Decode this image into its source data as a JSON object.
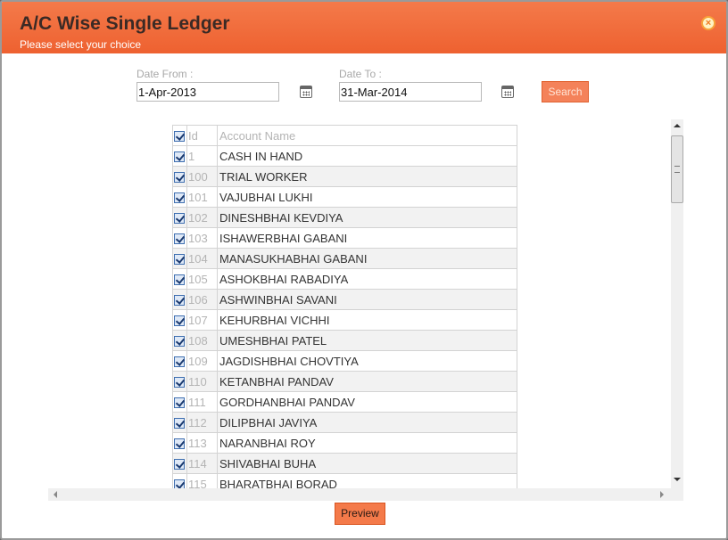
{
  "dialog": {
    "title": "A/C Wise Single Ledger",
    "subtitle": "Please select your choice",
    "close_icon": "close-icon"
  },
  "filters": {
    "date_from_label": "Date From :",
    "date_from_value": "1-Apr-2013",
    "date_to_label": "Date To :",
    "date_to_value": "31-Mar-2014",
    "calendar_icon": "calendar-icon",
    "search_label": "Search"
  },
  "grid": {
    "header": {
      "id": "Id",
      "name": "Account Name",
      "checked": true
    },
    "rows": [
      {
        "id": "1",
        "name": "CASH IN HAND",
        "checked": true
      },
      {
        "id": "100",
        "name": "TRIAL WORKER",
        "checked": true
      },
      {
        "id": "101",
        "name": "VAJUBHAI LUKHI",
        "checked": true
      },
      {
        "id": "102",
        "name": "DINESHBHAI KEVDIYA",
        "checked": true
      },
      {
        "id": "103",
        "name": "ISHAWERBHAI GABANI",
        "checked": true
      },
      {
        "id": "104",
        "name": "MANASUKHABHAI GABANI",
        "checked": true
      },
      {
        "id": "105",
        "name": "ASHOKBHAI RABADIYA",
        "checked": true
      },
      {
        "id": "106",
        "name": "ASHWINBHAI SAVANI",
        "checked": true
      },
      {
        "id": "107",
        "name": "KEHURBHAI VICHHI",
        "checked": true
      },
      {
        "id": "108",
        "name": "UMESHBHAI PATEL",
        "checked": true
      },
      {
        "id": "109",
        "name": "JAGDISHBHAI CHOVTIYA",
        "checked": true
      },
      {
        "id": "110",
        "name": "KETANBHAI PANDAV",
        "checked": true
      },
      {
        "id": "111",
        "name": "GORDHANBHAI PANDAV",
        "checked": true
      },
      {
        "id": "112",
        "name": "DILIPBHAI JAVIYA",
        "checked": true
      },
      {
        "id": "113",
        "name": "NARANBHAI ROY",
        "checked": true
      },
      {
        "id": "114",
        "name": "SHIVABHAI BUHA",
        "checked": true
      },
      {
        "id": "115",
        "name": "BHARATBHAI BORAD",
        "checked": true
      }
    ]
  },
  "footer": {
    "preview_label": "Preview"
  },
  "colors": {
    "titlebar": "#f26b3a",
    "button": "#f47a4a",
    "checkbox": "#3f6fb0"
  }
}
